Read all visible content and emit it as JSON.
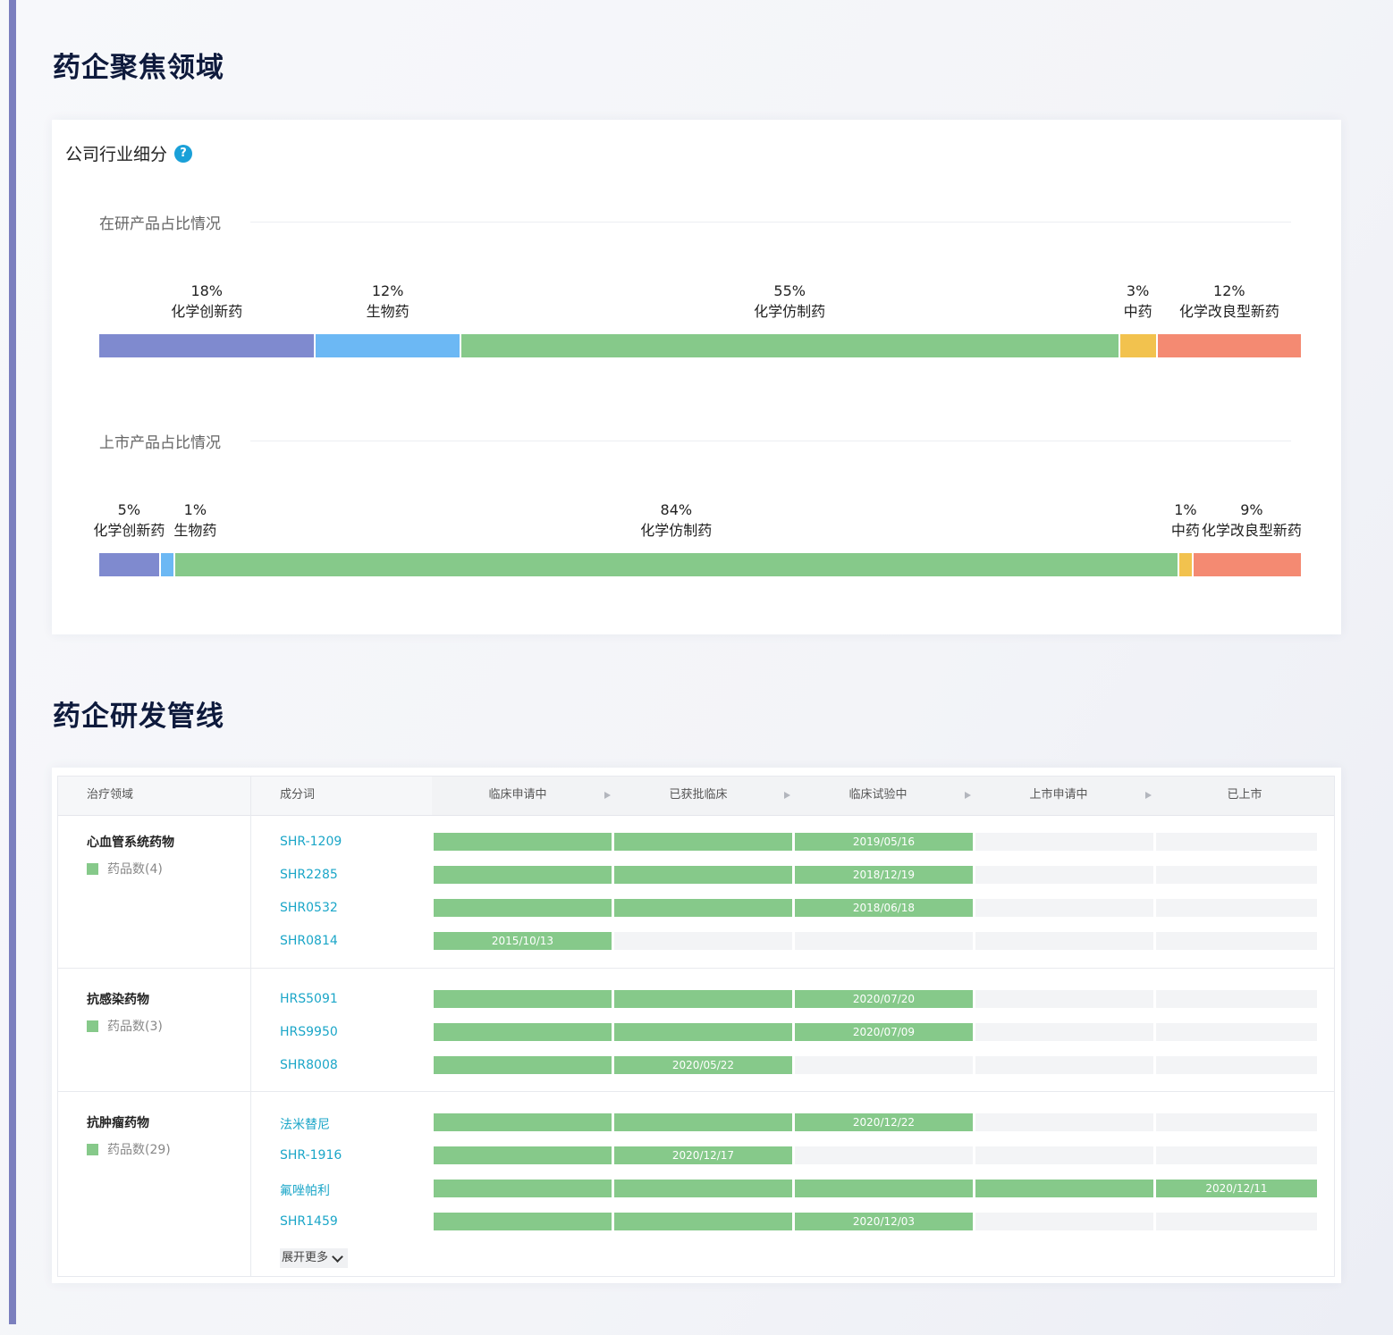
{
  "sections": {
    "focus_title": "药企聚焦领域",
    "pipeline_title": "药企研发管线"
  },
  "segment_card": {
    "title": "公司行业细分",
    "help_icon": "question-circle-icon",
    "research": {
      "subtitle": "在研产品占比情况",
      "segments": [
        {
          "pct": "18%",
          "name": "化学创新药",
          "value": 18,
          "color": "#7f8acf"
        },
        {
          "pct": "12%",
          "name": "生物药",
          "value": 12,
          "color": "#6cb8f4"
        },
        {
          "pct": "55%",
          "name": "化学仿制药",
          "value": 55,
          "color": "#86c98a"
        },
        {
          "pct": "3%",
          "name": "中药",
          "value": 3,
          "color": "#f2c24e"
        },
        {
          "pct": "12%",
          "name": "化学改良型新药",
          "value": 12,
          "color": "#f48a72"
        }
      ]
    },
    "market": {
      "subtitle": "上市产品占比情况",
      "segments": [
        {
          "pct": "5%",
          "name": "化学创新药",
          "value": 5,
          "color": "#7f8acf"
        },
        {
          "pct": "1%",
          "name": "生物药",
          "value": 1,
          "color": "#6cb8f4"
        },
        {
          "pct": "84%",
          "name": "化学仿制药",
          "value": 84,
          "color": "#86c98a"
        },
        {
          "pct": "1%",
          "name": "中药",
          "value": 1,
          "color": "#f2c24e"
        },
        {
          "pct": "9%",
          "name": "化学改良型新药",
          "value": 9,
          "color": "#f48a72"
        }
      ]
    }
  },
  "pipeline": {
    "headers": {
      "area": "治疗领域",
      "ingredient": "成分词",
      "stages": [
        "临床申请中",
        "已获批临床",
        "临床试验中",
        "上市申请中",
        "已上市"
      ]
    },
    "groups": [
      {
        "name": "心血管系统药物",
        "count": "药品数(4)",
        "drugs": [
          {
            "name": "SHR-1209",
            "stage": 3,
            "date": "2019/05/16"
          },
          {
            "name": "SHR2285",
            "stage": 3,
            "date": "2018/12/19"
          },
          {
            "name": "SHR0532",
            "stage": 3,
            "date": "2018/06/18"
          },
          {
            "name": "SHR0814",
            "stage": 1,
            "date": "2015/10/13"
          }
        ]
      },
      {
        "name": "抗感染药物",
        "count": "药品数(3)",
        "drugs": [
          {
            "name": "HRS5091",
            "stage": 3,
            "date": "2020/07/20"
          },
          {
            "name": "HRS9950",
            "stage": 3,
            "date": "2020/07/09"
          },
          {
            "name": "SHR8008",
            "stage": 2,
            "date": "2020/05/22"
          }
        ]
      },
      {
        "name": "抗肿瘤药物",
        "count": "药品数(29)",
        "drugs": [
          {
            "name": "法米替尼",
            "stage": 3,
            "date": "2020/12/22"
          },
          {
            "name": "SHR-1916",
            "stage": 2,
            "date": "2020/12/17"
          },
          {
            "name": "氟唑帕利",
            "stage": 5,
            "date": "2020/12/11"
          },
          {
            "name": "SHR1459",
            "stage": 3,
            "date": "2020/12/03"
          }
        ]
      }
    ],
    "expand_label": "展开更多",
    "colors": {
      "done": "#86c98a",
      "pending": "#f3f4f6",
      "link": "#1ba6c8"
    }
  }
}
